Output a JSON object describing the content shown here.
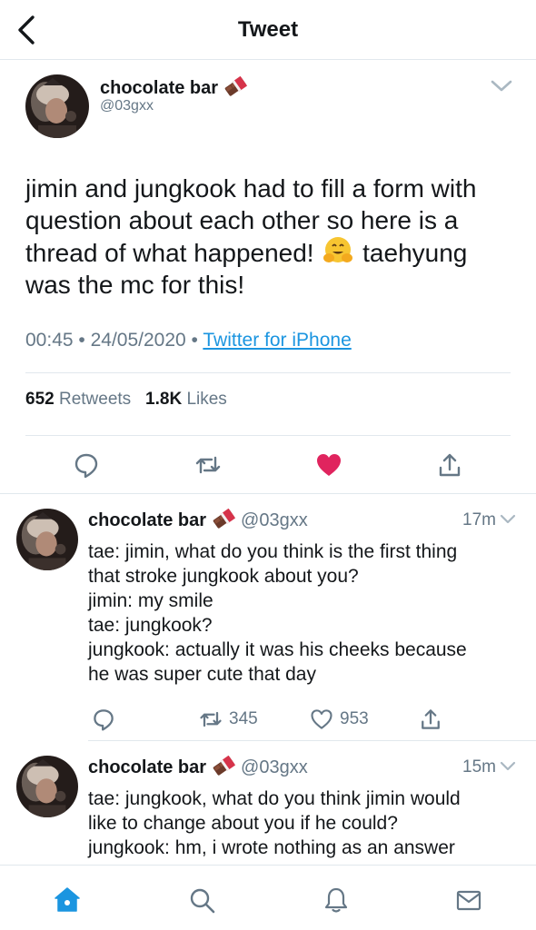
{
  "header": {
    "title": "Tweet",
    "back_icon": "chevron-left-icon"
  },
  "main_tweet": {
    "name": "chocolate bar",
    "handle": "@03gxx",
    "text_lines": [
      "jimin and jungkook had to fill a form with",
      "question about each other so here is a",
      "thread of what happened!",
      "taehyung",
      "was the mc for this!"
    ],
    "time": "00:45",
    "date": "24/05/2020",
    "source": "Twitter for iPhone",
    "retweets_count": "652",
    "retweets_label": "Retweets",
    "likes_count": "1.8K",
    "likes_label": "Likes",
    "liked": true,
    "accent_color": "#1b95e0",
    "like_color": "#e0245e"
  },
  "replies": [
    {
      "name": "chocolate bar",
      "handle": "@03gxx",
      "time": "17m",
      "lines": [
        "tae: jimin, what do you think is the first thing",
        "that stroke jungkook about you?",
        "jimin: my smile",
        "tae: jungkook?",
        "jungkook: actually it was his cheeks because",
        "he was super cute that day"
      ],
      "retweets": "345",
      "likes": "953"
    },
    {
      "name": "chocolate bar",
      "handle": "@03gxx",
      "time": "15m",
      "lines": [
        "tae: jungkook, what do you think jimin would",
        "like to change about you if he could?",
        "jungkook: hm, i wrote nothing as an answer"
      ]
    }
  ],
  "tabbar": {
    "items": [
      "home-icon",
      "search-icon",
      "notifications-icon",
      "messages-icon"
    ]
  }
}
